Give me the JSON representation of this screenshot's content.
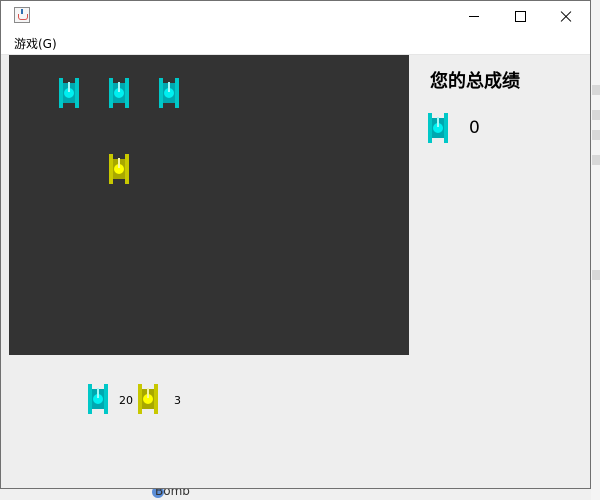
{
  "menu": {
    "game_label": "游戏(G)"
  },
  "scoreboard": {
    "title": "您的总成绩",
    "score": "0"
  },
  "counters": {
    "enemy_count": "20",
    "player_count": "3"
  },
  "background_app": {
    "peek_text": "Bomb"
  },
  "colors": {
    "enemy_tank": "#00e0e0",
    "player_tank": "#e0e000",
    "game_background": "#333333",
    "panel_background": "#eeeeee"
  },
  "icons": [
    "java-app-icon",
    "minimize-icon",
    "maximize-icon",
    "close-icon",
    "enemy-tank-icon",
    "player-tank-icon"
  ]
}
